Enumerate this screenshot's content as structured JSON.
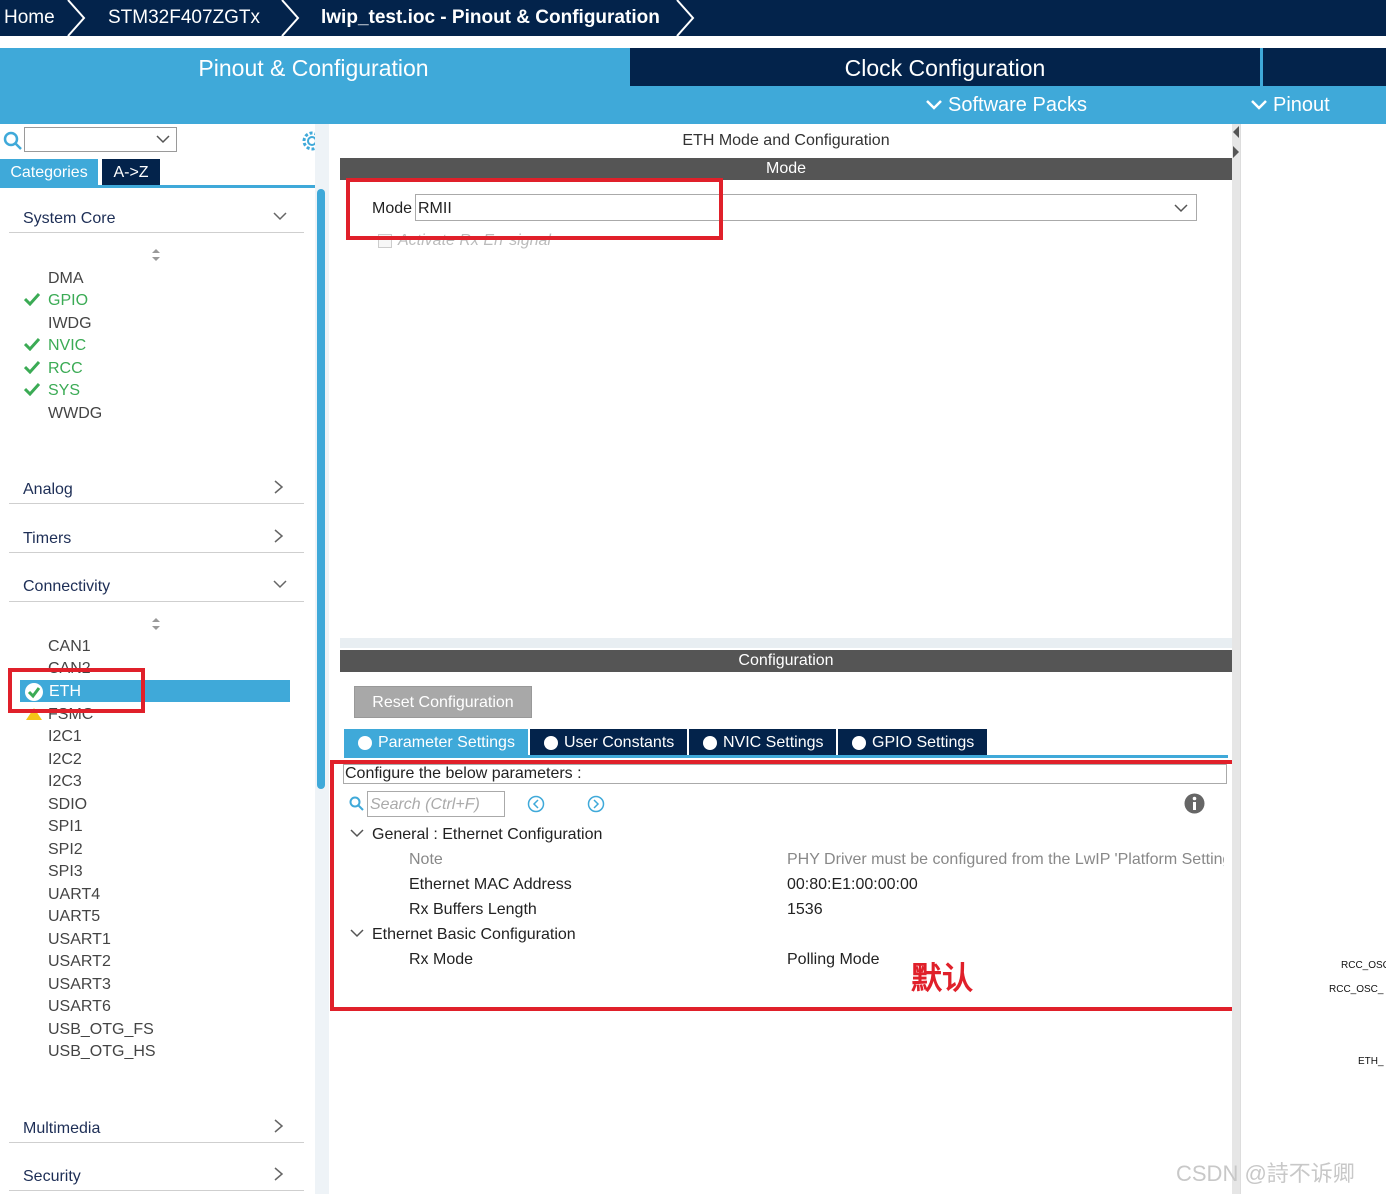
{
  "breadcrumb": {
    "home": "Home",
    "device": "STM32F407ZGTx",
    "file": "lwip_test.ioc - Pinout & Configuration"
  },
  "main_tabs": {
    "pinout_config": "Pinout & Configuration",
    "clock_config": "Clock Configuration",
    "software_packs": "Software Packs",
    "pinout": "Pinout"
  },
  "left": {
    "category_tabs": [
      "Categories",
      "A->Z"
    ],
    "sections": {
      "system_core": "System Core",
      "analog": "Analog",
      "timers": "Timers",
      "connectivity": "Connectivity",
      "multimedia": "Multimedia",
      "security": "Security"
    },
    "system_core_items": [
      "DMA",
      "GPIO",
      "IWDG",
      "NVIC",
      "RCC",
      "SYS",
      "WWDG"
    ],
    "connectivity_items": [
      "CAN1",
      "CAN2",
      "ETH",
      "FSMC",
      "I2C1",
      "I2C2",
      "I2C3",
      "SDIO",
      "SPI1",
      "SPI2",
      "SPI3",
      "UART4",
      "UART5",
      "USART1",
      "USART2",
      "USART3",
      "USART6",
      "USB_OTG_FS",
      "USB_OTG_HS"
    ]
  },
  "center": {
    "title": "ETH Mode and Configuration",
    "mode_header": "Mode",
    "mode_label": "Mode",
    "mode_value": "RMII",
    "activate_rx_err": "Activate Rx Err signal",
    "config_header": "Configuration",
    "reset_button": "Reset Configuration",
    "param_tabs": [
      "Parameter Settings",
      "User Constants",
      "NVIC Settings",
      "GPIO Settings"
    ],
    "configure_text": "Configure the below parameters :",
    "search_placeholder": "Search (Ctrl+F)",
    "groups": {
      "general": "General : Ethernet Configuration",
      "basic": "Ethernet Basic Configuration"
    },
    "params": {
      "note_label": "Note",
      "note_value": "PHY Driver must be configured from the LwIP 'Platform Setting...",
      "mac_label": "Ethernet MAC Address",
      "mac_value": "00:80:E1:00:00:00",
      "rxbuf_label": "Rx Buffers Length",
      "rxbuf_value": "1536",
      "rxmode_label": "Rx Mode",
      "rxmode_value": "Polling Mode"
    },
    "annotation": "默认"
  },
  "right_pins": [
    "RCC_OSC",
    "RCC_OSC_",
    "ETH_"
  ],
  "watermark": "CSDN @詩不诉卿",
  "colors": {
    "navy": "#03234b",
    "blue": "#3fa9d9",
    "green": "#3bab55",
    "red": "#e0202a"
  }
}
